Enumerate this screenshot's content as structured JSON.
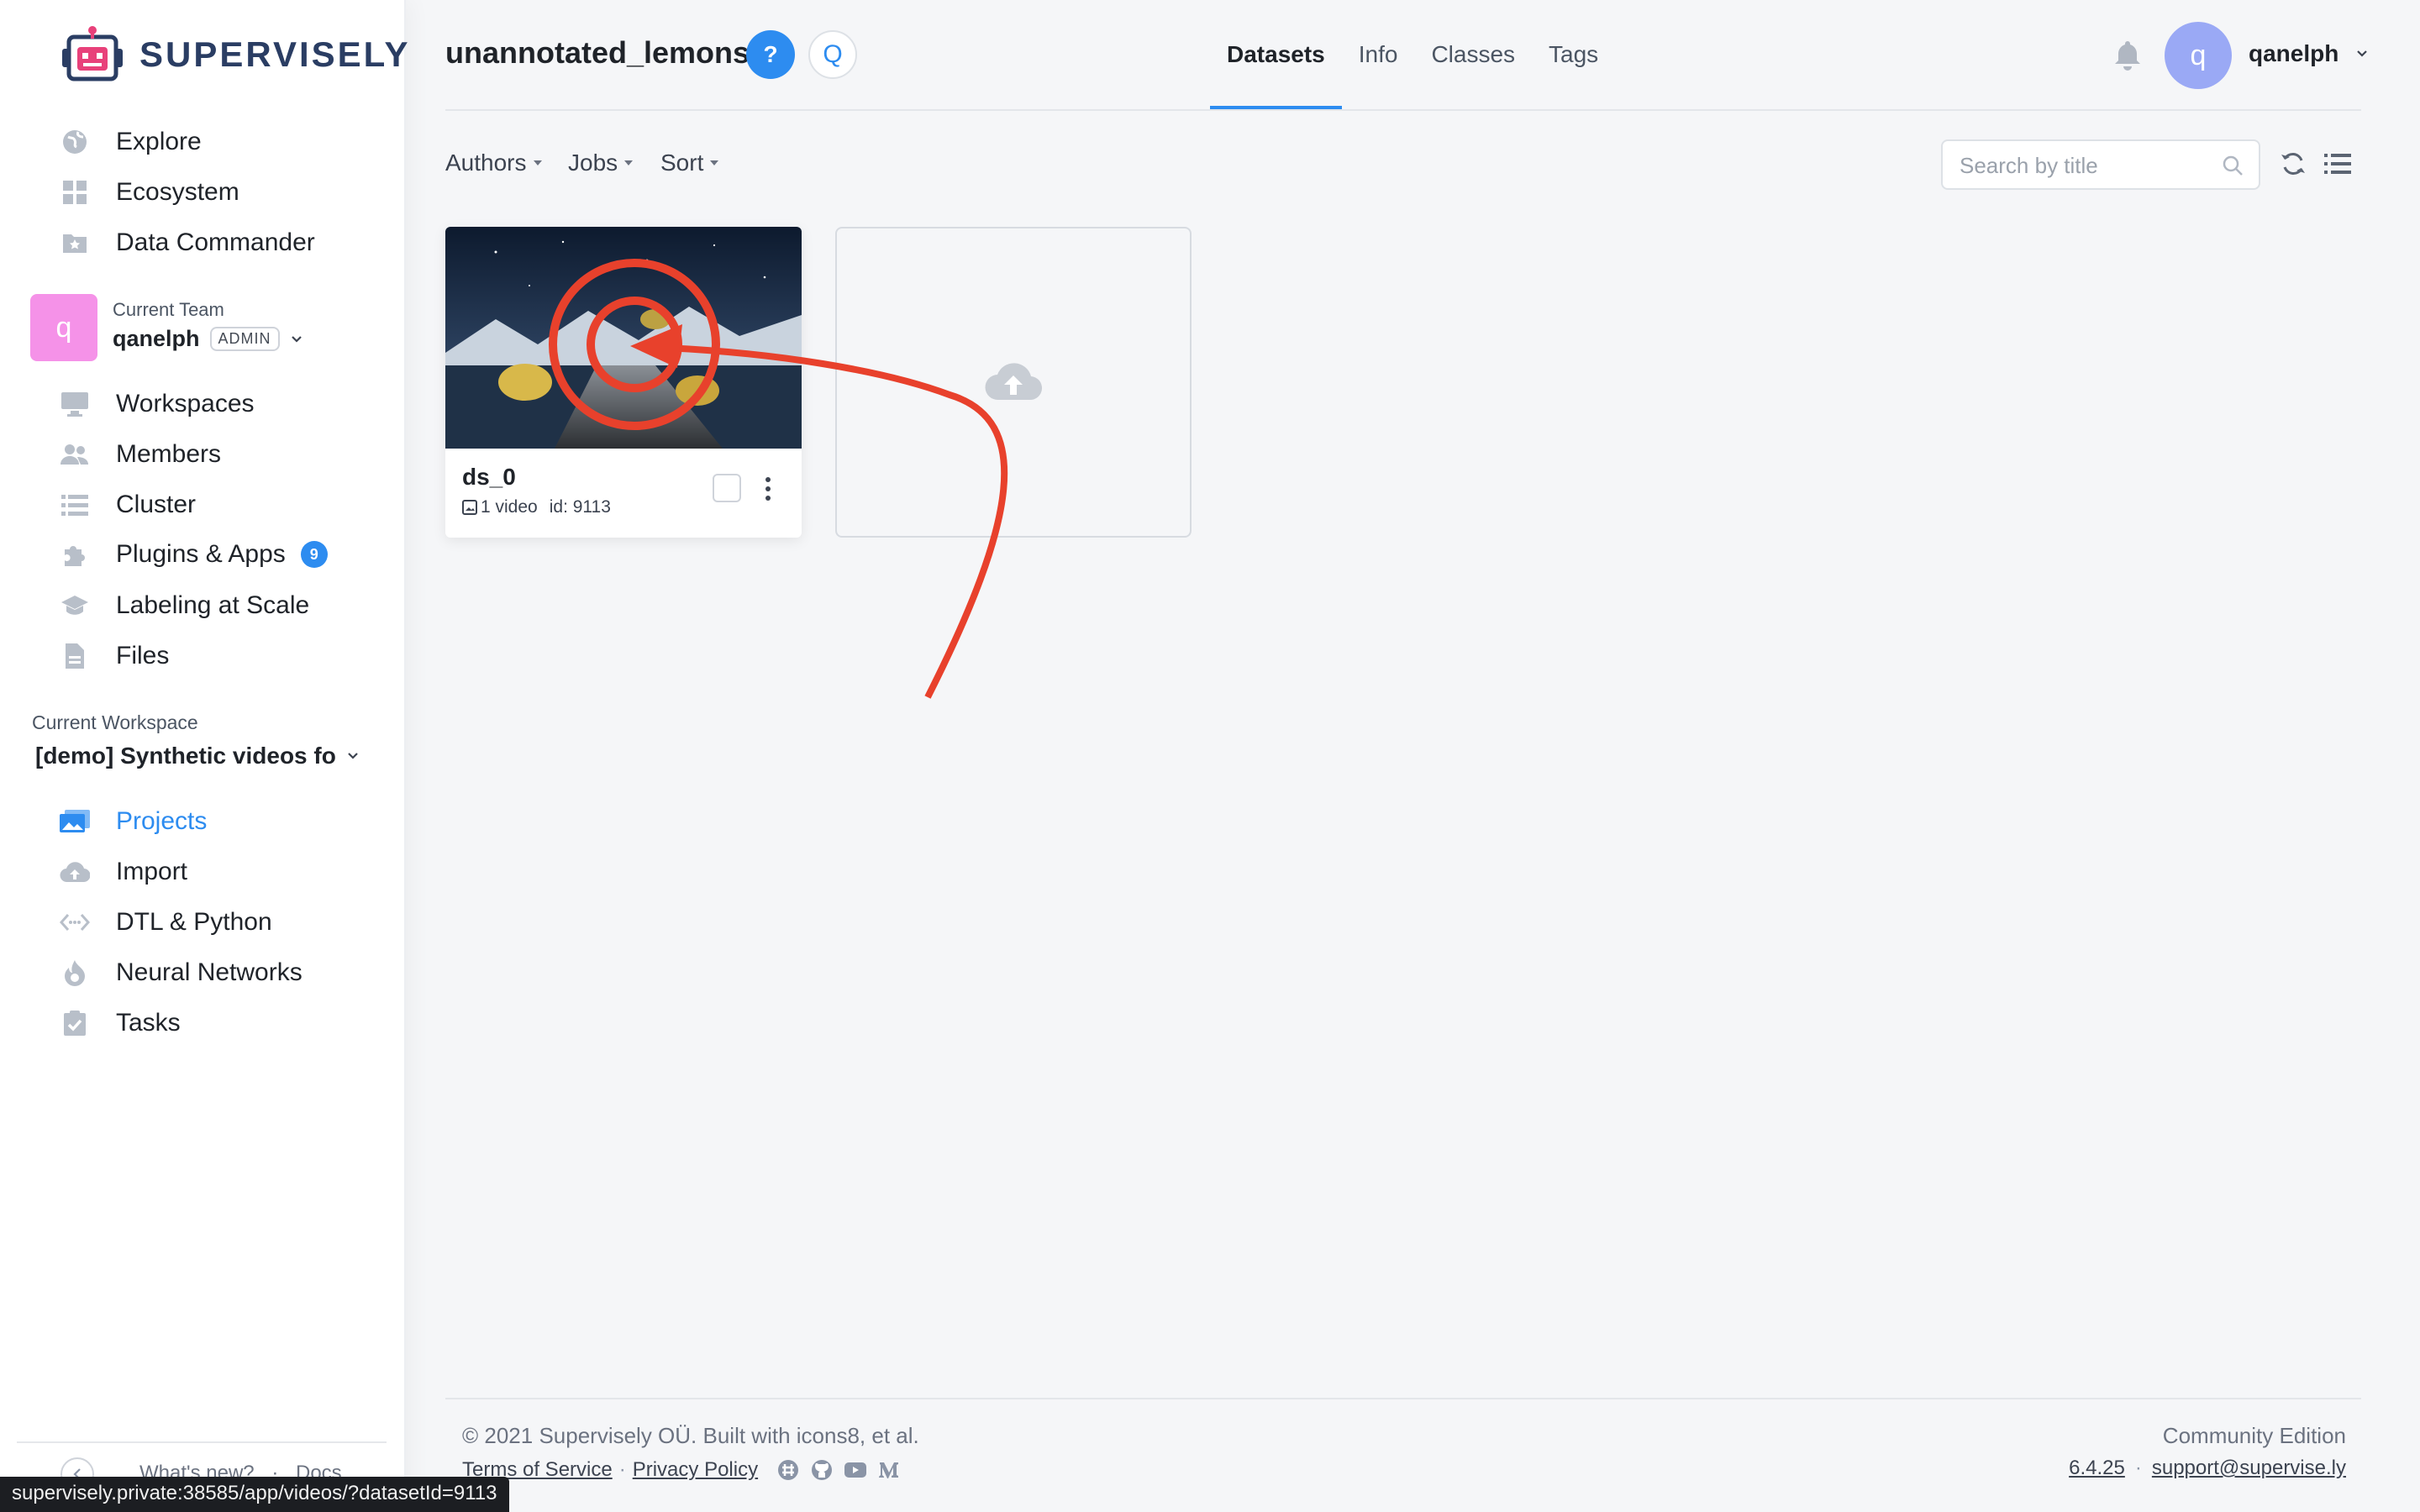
{
  "brand": {
    "name": "SUPERVISELY",
    "colors": {
      "accent": "#2d8cf0",
      "brand_dark": "#2a3d63",
      "brand_pink": "#e8417a",
      "arrow": "#e8412c"
    }
  },
  "sidebar": {
    "top_items": [
      {
        "label": "Explore",
        "icon": "globe-icon"
      },
      {
        "label": "Ecosystem",
        "icon": "apps-grid-icon"
      },
      {
        "label": "Data Commander",
        "icon": "folder-star-icon"
      }
    ],
    "team": {
      "avatar_letter": "q",
      "caption": "Current Team",
      "name": "qanelph",
      "role": "ADMIN"
    },
    "team_items": [
      {
        "label": "Workspaces",
        "icon": "monitor-icon"
      },
      {
        "label": "Members",
        "icon": "people-icon"
      },
      {
        "label": "Cluster",
        "icon": "list-icon"
      },
      {
        "label": "Plugins & Apps",
        "icon": "puzzle-icon",
        "badge": "9"
      },
      {
        "label": "Labeling at Scale",
        "icon": "graduation-cap-icon"
      },
      {
        "label": "Files",
        "icon": "file-icon"
      }
    ],
    "workspace": {
      "caption": "Current Workspace",
      "name": "[demo] Synthetic videos fo"
    },
    "ws_items": [
      {
        "label": "Projects",
        "icon": "images-icon",
        "active": true
      },
      {
        "label": "Import",
        "icon": "cloud-upload-icon"
      },
      {
        "label": "DTL & Python",
        "icon": "code-icon"
      },
      {
        "label": "Neural Networks",
        "icon": "flame-icon"
      },
      {
        "label": "Tasks",
        "icon": "clipboard-check-icon"
      }
    ],
    "bottom": {
      "whats_new": "What's new?",
      "sep": "·",
      "docs": "Docs"
    }
  },
  "header": {
    "title": "unannotated_lemons",
    "help_label": "?",
    "q_label": "Q",
    "tabs": [
      {
        "label": "Datasets",
        "active": true
      },
      {
        "label": "Info"
      },
      {
        "label": "Classes"
      },
      {
        "label": "Tags"
      }
    ],
    "user": {
      "avatar_letter": "q",
      "name": "qanelph"
    }
  },
  "toolbar": {
    "filters": [
      "Authors",
      "Jobs",
      "Sort"
    ],
    "search_placeholder": "Search by title"
  },
  "datasets": [
    {
      "name": "ds_0",
      "count": "1 video",
      "id": "id: 9113"
    }
  ],
  "footer": {
    "copyright": "© 2021 Supervisely OÜ. Built with icons8, et al.",
    "terms": "Terms of Service",
    "dot": "·",
    "privacy": "Privacy Policy",
    "edition": "Community Edition",
    "version": "6.4.25",
    "support": "support@supervise.ly",
    "social_icons": [
      "slack-icon",
      "github-icon",
      "youtube-icon",
      "medium-icon"
    ]
  },
  "statusbar": {
    "url": "supervisely.private:38585/app/videos/?datasetId=9113"
  }
}
